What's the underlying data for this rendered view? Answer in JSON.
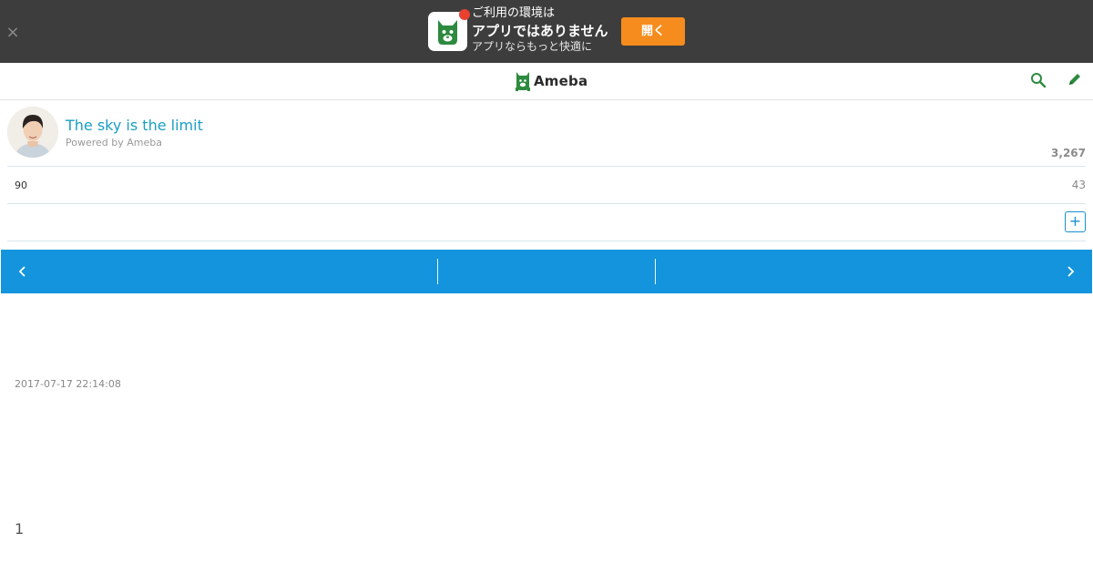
{
  "app_banner": {
    "close_icon": "close-icon",
    "line1": "ご利用の環境は",
    "line2": "アプリではありません",
    "line3": "アプリならもっと快適に",
    "open_label": "開く",
    "colors": {
      "background": "#3d3d3d",
      "button": "#f68c1e",
      "badge": "#e8412f",
      "brand_green": "#2d8a3e"
    }
  },
  "header": {
    "logo_text": "Ameba",
    "search_icon": "search-icon",
    "edit_icon": "pencil-icon"
  },
  "profile": {
    "blog_title": "The sky is the limit",
    "powered_by": "Powered by Ameba",
    "reader_count": "3,267"
  },
  "stats": {
    "left_value": "90",
    "right_value": "43"
  },
  "follow": {
    "plus_label": "+"
  },
  "pager": {
    "prev_icon": "chevron-left-icon",
    "next_icon": "chevron-right-icon",
    "color": "#1494dc"
  },
  "post": {
    "date": "2017-07-17 22:14:08",
    "page_number": "1"
  }
}
